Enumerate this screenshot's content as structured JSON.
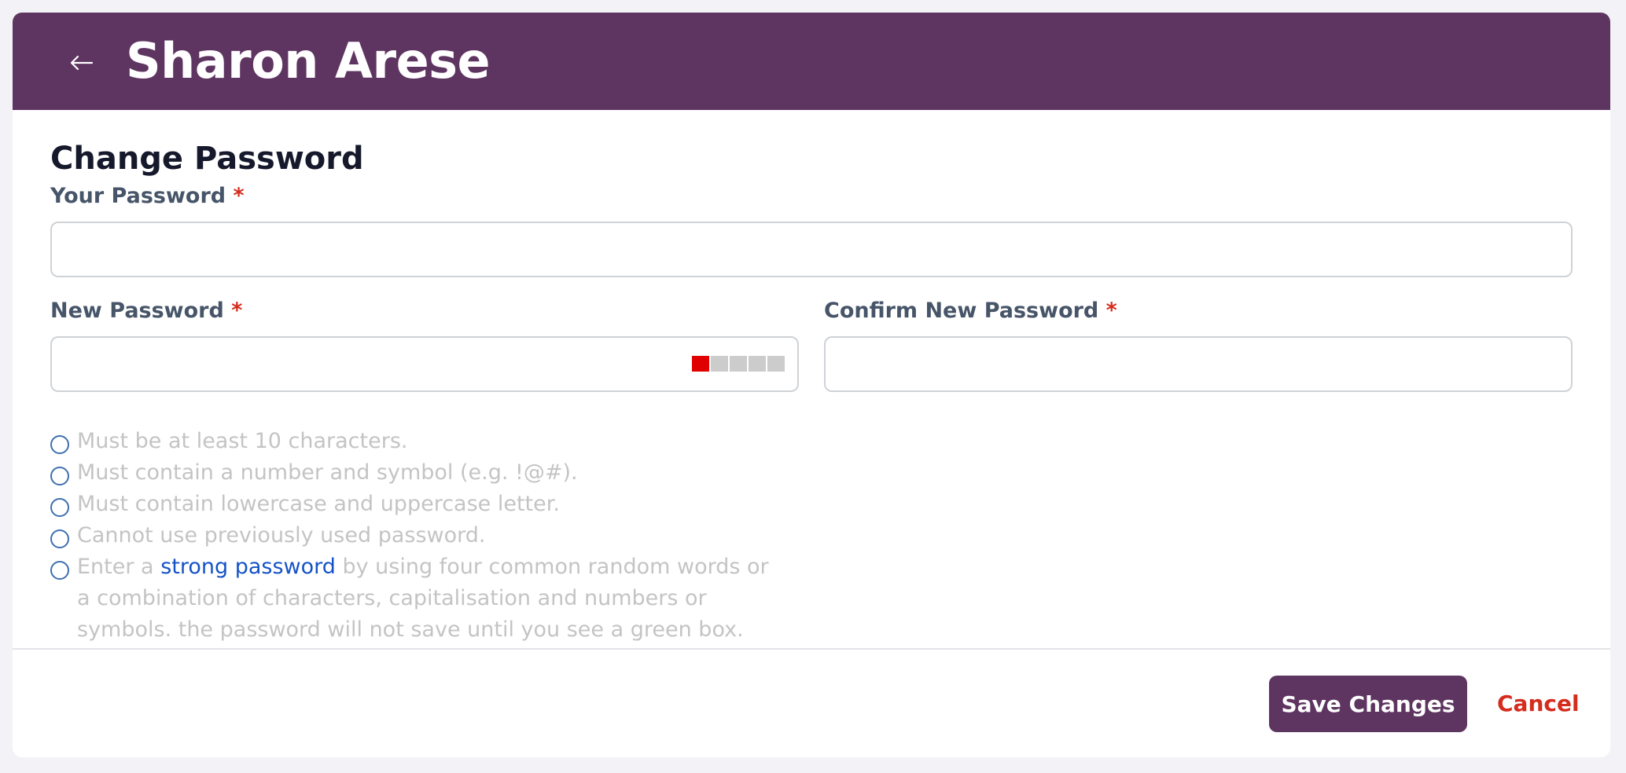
{
  "header": {
    "title": "Sharon Arese",
    "back_icon": "arrow-left-icon",
    "background": "#5e3561"
  },
  "form": {
    "section_title": "Change Password",
    "required_marker": "*",
    "current_password": {
      "label": "Your Password",
      "value": "",
      "placeholder": ""
    },
    "new_password": {
      "label": "New Password",
      "value": "",
      "placeholder": ""
    },
    "confirm_password": {
      "label": "Confirm New Password",
      "value": "",
      "placeholder": ""
    },
    "strength_meter": {
      "segments": 5,
      "active": 1,
      "active_color": "#e00000"
    }
  },
  "rules": [
    {
      "text": "Must be at least 10 characters."
    },
    {
      "text": "Must contain a number and symbol (e.g. !@#)."
    },
    {
      "text": "Must contain lowercase and uppercase letter."
    },
    {
      "text": "Cannot use previously used password."
    },
    {
      "prefix": "Enter a ",
      "link": "strong password",
      "suffix": " by using four common random words or a combination of characters, capitalisation and numbers or symbols. the password will not save until you see a green box."
    }
  ],
  "footer": {
    "save_label": "Save Changes",
    "cancel_label": "Cancel"
  }
}
